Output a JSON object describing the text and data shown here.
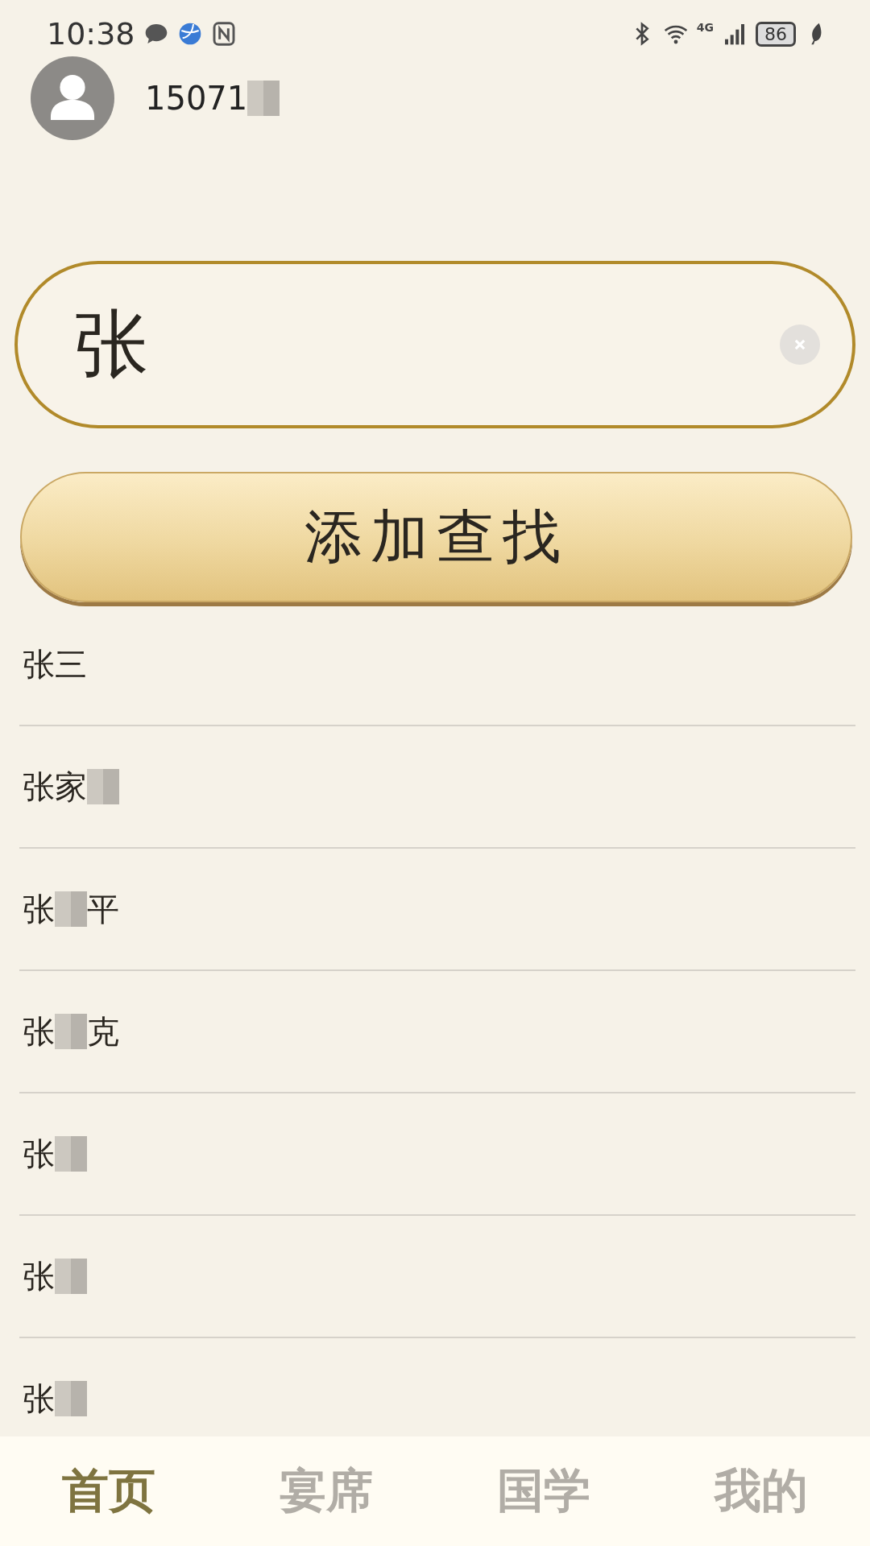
{
  "status_bar": {
    "time": "10:38",
    "battery": "86",
    "network": "4G"
  },
  "account": {
    "parts": [
      {
        "kind": "text",
        "text": "15071"
      },
      {
        "kind": "blur"
      }
    ]
  },
  "search": {
    "value": "张"
  },
  "add_button": {
    "label": "添加查找"
  },
  "results": [
    {
      "parts": [
        {
          "kind": "text",
          "text": "张三"
        }
      ]
    },
    {
      "parts": [
        {
          "kind": "text",
          "text": "张家"
        },
        {
          "kind": "blur"
        }
      ]
    },
    {
      "parts": [
        {
          "kind": "text",
          "text": "张"
        },
        {
          "kind": "blur"
        },
        {
          "kind": "text",
          "text": "平"
        }
      ]
    },
    {
      "parts": [
        {
          "kind": "text",
          "text": "张"
        },
        {
          "kind": "blur"
        },
        {
          "kind": "text",
          "text": "克"
        }
      ]
    },
    {
      "parts": [
        {
          "kind": "text",
          "text": "张"
        },
        {
          "kind": "blur"
        }
      ]
    },
    {
      "parts": [
        {
          "kind": "text",
          "text": "张"
        },
        {
          "kind": "blur"
        }
      ]
    },
    {
      "parts": [
        {
          "kind": "text",
          "text": "张"
        },
        {
          "kind": "blur"
        }
      ]
    }
  ],
  "tabs": [
    {
      "label": "首页",
      "selected": true
    },
    {
      "label": "宴席",
      "selected": false
    },
    {
      "label": "国学",
      "selected": false
    },
    {
      "label": "我的",
      "selected": false
    }
  ]
}
